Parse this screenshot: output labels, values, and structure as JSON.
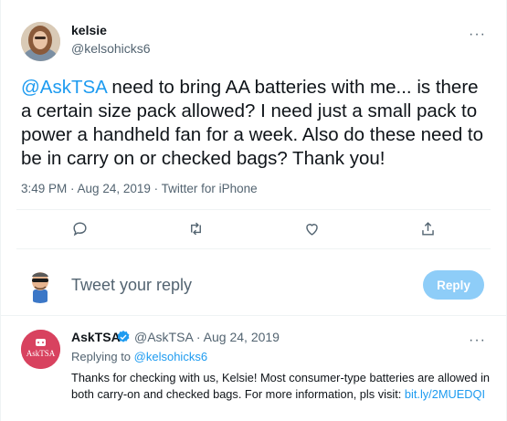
{
  "tweet": {
    "author_name": "kelsie",
    "author_handle": "@kelsohicks6",
    "text_mention": "@AskTSA",
    "text_body": " need to bring AA batteries with me... is there a certain size pack allowed? I need just a small pack to power a handheld fan for a week. Also do these need to be in carry on or checked bags? Thank you!",
    "time": "3:49 PM",
    "date": "Aug 24, 2019",
    "source": "Twitter for iPhone",
    "sep": " · "
  },
  "actions": {
    "icons": [
      "reply-icon",
      "retweet-icon",
      "like-icon",
      "share-icon"
    ]
  },
  "composer": {
    "placeholder": "Tweet your reply",
    "button_label": "Reply"
  },
  "reply": {
    "author_name": "AskTSA",
    "author_handle_date": "@AskTSA · Aug 24, 2019",
    "avatar_text": "AskTSA",
    "replying_prefix": "Replying to ",
    "replying_to": "@kelsohicks6",
    "body": "Thanks for checking with us, Kelsie! Most consumer-type batteries are allowed in both carry-on and checked bags. For more information, pls visit: ",
    "link": "bit.ly/2MUEDQI"
  },
  "more_glyph": "···",
  "colors": {
    "accent": "#1d9bf0",
    "reply_button": "#8ecdf8",
    "secondary_text": "#536471",
    "tsa_avatar": "#d8425f"
  }
}
